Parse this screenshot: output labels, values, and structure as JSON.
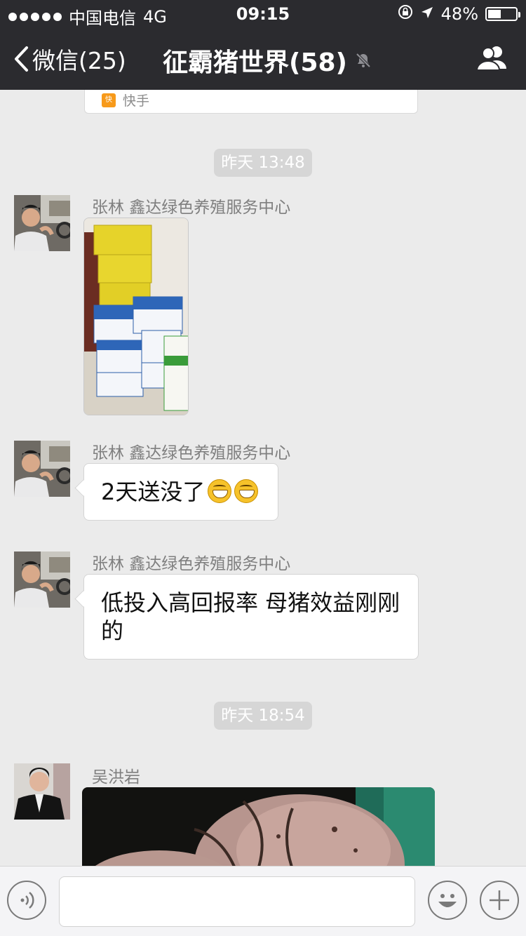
{
  "status_bar": {
    "carrier": "中国电信",
    "network": "4G",
    "time": "09:15",
    "battery_percent": "48%",
    "battery_level": 0.48
  },
  "nav": {
    "back_label": "微信(25)",
    "title": "征霸猪世界(58)"
  },
  "top_card": {
    "source": "快手",
    "logo_text": "快"
  },
  "messages": [
    {
      "type": "time",
      "text": "昨天 13:48"
    },
    {
      "type": "image",
      "sender": "张林  鑫达绿色养殖服务中心"
    },
    {
      "type": "text",
      "sender": "张林  鑫达绿色养殖服务中心",
      "text": "2天送没了"
    },
    {
      "type": "text",
      "sender": "张林  鑫达绿色养殖服务中心",
      "text": "低投入高回报率 母猪效益刚刚的"
    },
    {
      "type": "time",
      "text": "昨天 18:54"
    },
    {
      "type": "image",
      "sender": "吴洪岩"
    }
  ],
  "input": {
    "value": "",
    "placeholder": ""
  },
  "colors": {
    "bar_bg": "#2b2b2f",
    "chat_bg": "#ebebeb",
    "bubble_bg": "#ffffff"
  }
}
